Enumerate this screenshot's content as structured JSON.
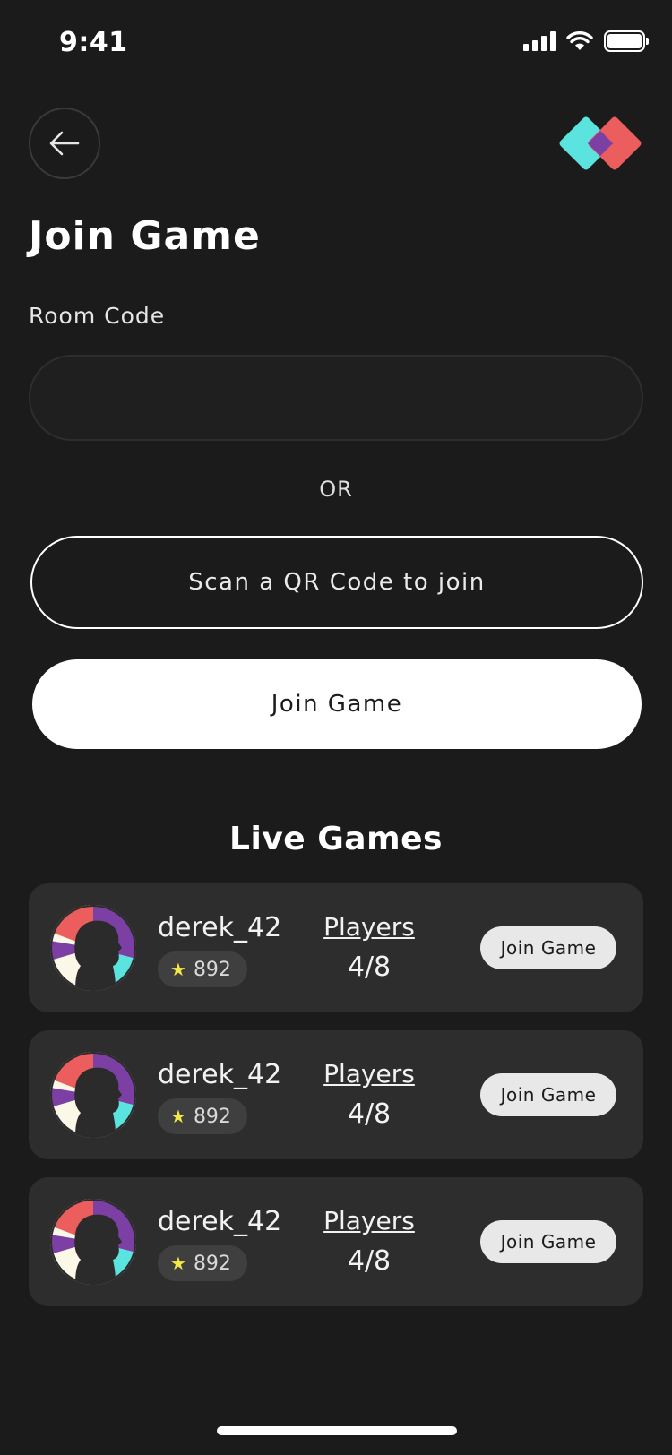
{
  "status_bar": {
    "time": "9:41"
  },
  "header": {
    "back_icon": "arrow-left-icon",
    "logo": "diamond-logo"
  },
  "title": "Join Game",
  "room_code": {
    "label": "Room Code",
    "value": "",
    "placeholder": ""
  },
  "or_text": "OR",
  "qr_button_label": "Scan a QR Code to join",
  "join_button_label": "Join Game",
  "live_games": {
    "title": "Live Games",
    "games": [
      {
        "username": "derek_42",
        "rating": "892",
        "players_label": "Players",
        "players": "4/8",
        "join_label": "Join Game"
      },
      {
        "username": "derek_42",
        "rating": "892",
        "players_label": "Players",
        "players": "4/8",
        "join_label": "Join Game"
      },
      {
        "username": "derek_42",
        "rating": "892",
        "players_label": "Players",
        "players": "4/8",
        "join_label": "Join Game"
      }
    ]
  },
  "colors": {
    "background": "#1b1b1b",
    "card": "#2d2d2d",
    "cyan": "#5be3df",
    "coral": "#ec5d5d",
    "purple": "#7c3fa3",
    "star": "#f3e845"
  }
}
